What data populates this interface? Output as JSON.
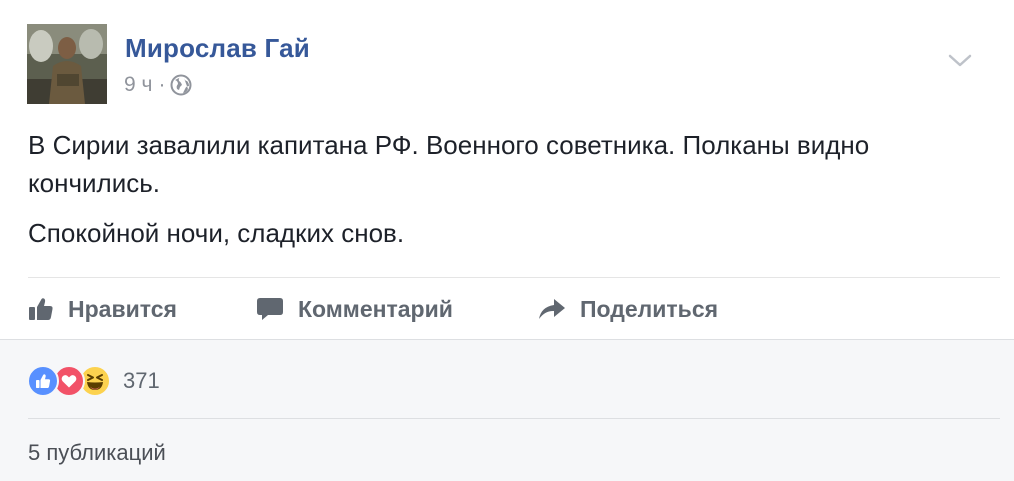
{
  "post": {
    "author": "Мирослав Гай",
    "time": "9 ч",
    "separator": "·",
    "privacy_icon": "globe-icon",
    "paragraphs": [
      "В Сирии завалили капитана РФ. Военного советника. Полканы видно кончились.",
      "Спокойной ночи, сладких снов."
    ]
  },
  "actions": {
    "like": "Нравится",
    "comment": "Комментарий",
    "share": "Поделиться"
  },
  "footer": {
    "reactions": [
      "like-icon",
      "love-icon",
      "haha-icon"
    ],
    "reaction_count": "371",
    "shares": "5 публикаций"
  },
  "colors": {
    "author_link": "#365899",
    "text": "#1d2129",
    "muted": "#90949c",
    "action": "#606770",
    "like_blue": "#5890ff",
    "love_red": "#f25268",
    "haha_yellow": "#fcd24f"
  }
}
